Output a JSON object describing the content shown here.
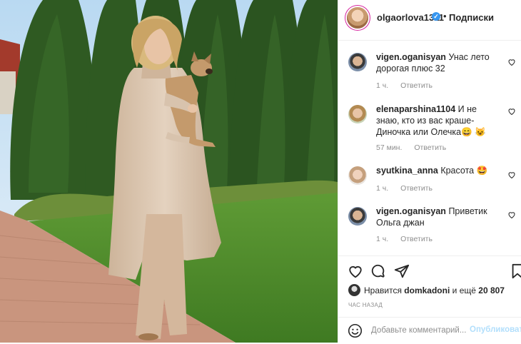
{
  "post": {
    "username": "olgaorlova1311",
    "separator": "•",
    "follow_label": "Подписки"
  },
  "comments": [
    {
      "username": "vigen.oganisyan",
      "text": "Унас лето дорогая плюс 32",
      "time": "1 ч.",
      "reply": "Ответить"
    },
    {
      "username": "elenaparshina1104",
      "text": "И не знаю, кто из вас краше- Диночка или Олечка😄 😺",
      "time": "57 мин.",
      "reply": "Ответить"
    },
    {
      "username": "syutkina_anna",
      "text": "Красота 🤩",
      "time": "1 ч.",
      "reply": "Ответить"
    },
    {
      "username": "vigen.oganisyan",
      "text": "Приветик Ольга джан",
      "time": "1 ч.",
      "reply": "Ответить"
    }
  ],
  "likes": {
    "prefix": "Нравится",
    "user": "domkadoni",
    "middle": "и ещё",
    "count": "20 807"
  },
  "timestamp": "ЧАС НАЗАД",
  "add_comment": {
    "placeholder": "Добавьте комментарий...",
    "publish_label": "Опубликовать"
  },
  "icons": {
    "verified": "verified-badge-icon",
    "like": "heart-icon",
    "comment": "comment-bubble-icon",
    "share": "paper-plane-icon",
    "save": "bookmark-icon",
    "emoji": "smiley-icon"
  },
  "colors": {
    "verified": "#3897f0",
    "muted_text": "#8e8e8e",
    "publish_disabled": "#b2dffc",
    "border": "#efefef"
  }
}
